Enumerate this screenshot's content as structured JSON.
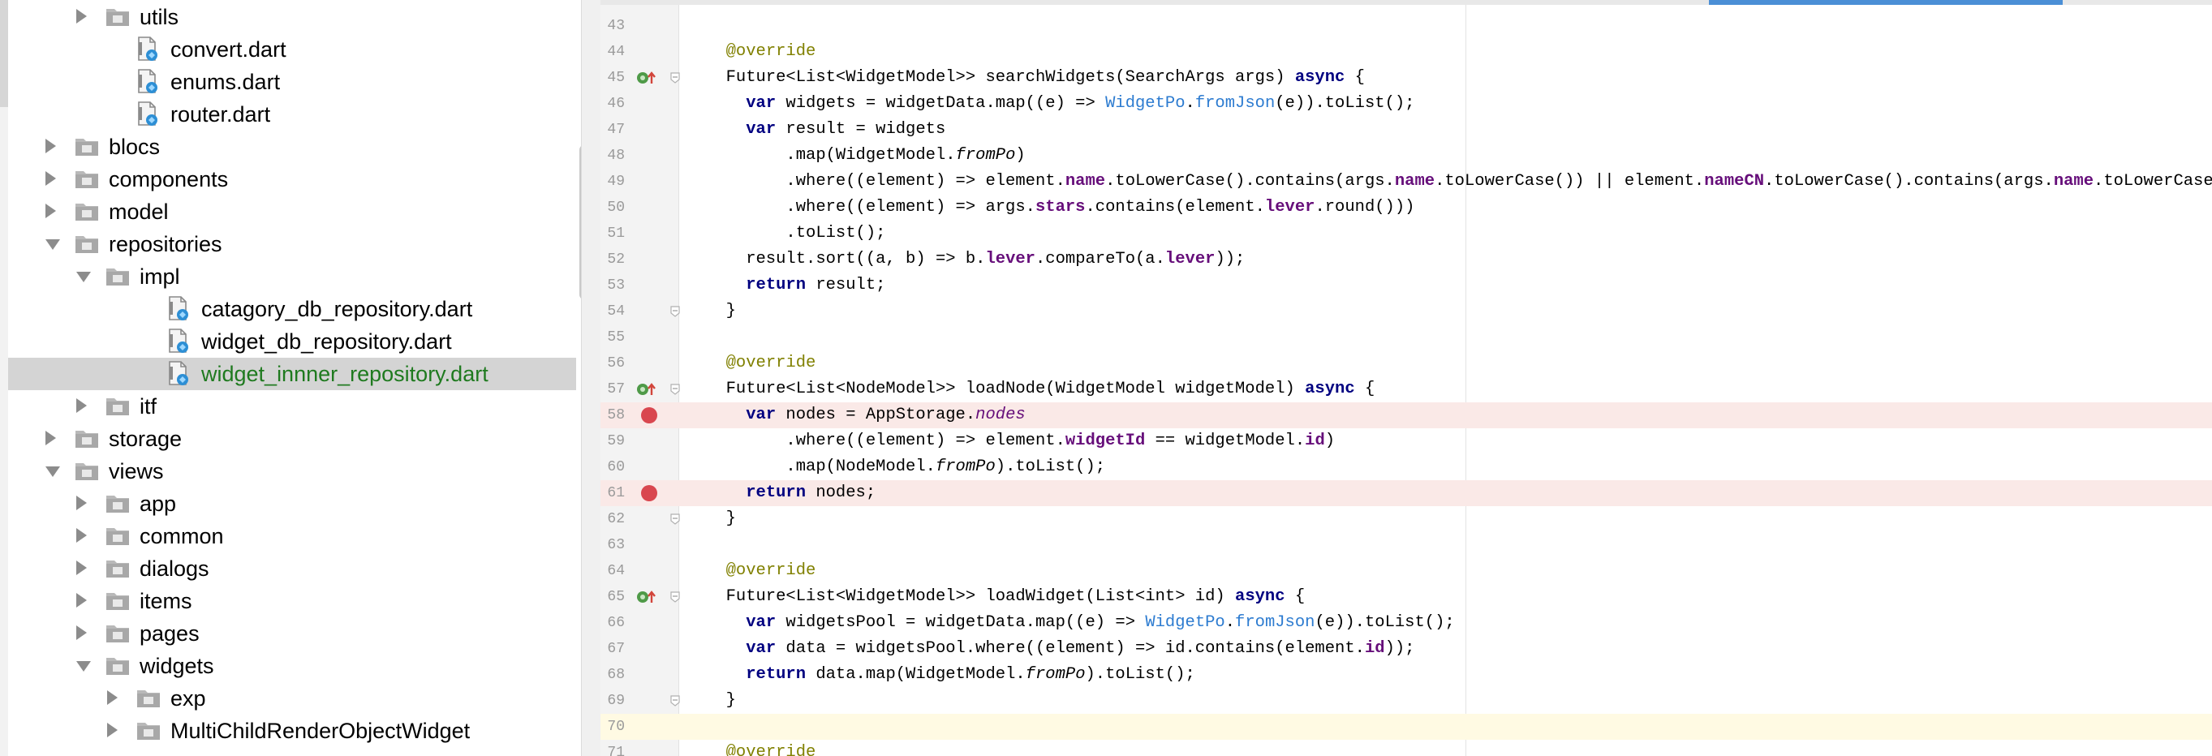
{
  "project_tree": {
    "items": [
      {
        "label": "utils",
        "kind": "folder",
        "state": "collapsed",
        "depth": 2
      },
      {
        "label": "convert.dart",
        "kind": "dart-file",
        "depth": 3
      },
      {
        "label": "enums.dart",
        "kind": "dart-file",
        "depth": 3
      },
      {
        "label": "router.dart",
        "kind": "dart-file",
        "depth": 3
      },
      {
        "label": "blocs",
        "kind": "folder",
        "state": "collapsed",
        "depth": 1
      },
      {
        "label": "components",
        "kind": "folder",
        "state": "collapsed",
        "depth": 1
      },
      {
        "label": "model",
        "kind": "folder",
        "state": "collapsed",
        "depth": 1
      },
      {
        "label": "repositories",
        "kind": "folder",
        "state": "expanded",
        "depth": 1
      },
      {
        "label": "impl",
        "kind": "folder",
        "state": "expanded",
        "depth": 2
      },
      {
        "label": "catagory_db_repository.dart",
        "kind": "dart-file",
        "depth": 4
      },
      {
        "label": "widget_db_repository.dart",
        "kind": "dart-file",
        "depth": 4
      },
      {
        "label": "widget_innner_repository.dart",
        "kind": "dart-file",
        "depth": 4,
        "selected": true
      },
      {
        "label": "itf",
        "kind": "folder",
        "state": "collapsed",
        "depth": 2
      },
      {
        "label": "storage",
        "kind": "folder",
        "state": "collapsed",
        "depth": 1
      },
      {
        "label": "views",
        "kind": "folder",
        "state": "expanded",
        "depth": 1
      },
      {
        "label": "app",
        "kind": "folder",
        "state": "collapsed",
        "depth": 2
      },
      {
        "label": "common",
        "kind": "folder",
        "state": "collapsed",
        "depth": 2
      },
      {
        "label": "dialogs",
        "kind": "folder",
        "state": "collapsed",
        "depth": 2
      },
      {
        "label": "items",
        "kind": "folder",
        "state": "collapsed",
        "depth": 2
      },
      {
        "label": "pages",
        "kind": "folder",
        "state": "collapsed",
        "depth": 2
      },
      {
        "label": "widgets",
        "kind": "folder",
        "state": "expanded",
        "depth": 2
      },
      {
        "label": "exp",
        "kind": "folder",
        "state": "collapsed",
        "depth": 3
      },
      {
        "label": "MultiChildRenderObjectWidget",
        "kind": "folder",
        "state": "collapsed",
        "depth": 3
      }
    ]
  },
  "editor": {
    "lines": [
      {
        "no": "43",
        "code": ""
      },
      {
        "no": "44",
        "code": "  @override"
      },
      {
        "no": "45",
        "code": "  Future<List<WidgetModel>> searchWidgets(SearchArgs args) async {",
        "override": true,
        "fold": true
      },
      {
        "no": "46",
        "code": "    var widgets = widgetData.map((e) => WidgetPo.fromJson(e)).toList();"
      },
      {
        "no": "47",
        "code": "    var result = widgets"
      },
      {
        "no": "48",
        "code": "        .map(WidgetModel.fromPo)"
      },
      {
        "no": "49",
        "code": "        .where((element) => element.name.toLowerCase().contains(args.name.toLowerCase()) || element.nameCN.toLowerCase().contains(args.name.toLowerCase()))"
      },
      {
        "no": "50",
        "code": "        .where((element) => args.stars.contains(element.lever.round()))"
      },
      {
        "no": "51",
        "code": "        .toList();"
      },
      {
        "no": "52",
        "code": "    result.sort((a, b) => b.lever.compareTo(a.lever));"
      },
      {
        "no": "53",
        "code": "    return result;"
      },
      {
        "no": "54",
        "code": "  }",
        "fold": true
      },
      {
        "no": "55",
        "code": ""
      },
      {
        "no": "56",
        "code": "  @override"
      },
      {
        "no": "57",
        "code": "  Future<List<NodeModel>> loadNode(WidgetModel widgetModel) async {",
        "override": true,
        "fold": true
      },
      {
        "no": "58",
        "code": "    var nodes = AppStorage.nodes",
        "breakpoint": true
      },
      {
        "no": "59",
        "code": "        .where((element) => element.widgetId == widgetModel.id)"
      },
      {
        "no": "60",
        "code": "        .map(NodeModel.fromPo).toList();"
      },
      {
        "no": "61",
        "code": "    return nodes;",
        "breakpoint": true
      },
      {
        "no": "62",
        "code": "  }",
        "fold": true
      },
      {
        "no": "63",
        "code": ""
      },
      {
        "no": "64",
        "code": "  @override"
      },
      {
        "no": "65",
        "code": "  Future<List<WidgetModel>> loadWidget(List<int> id) async {",
        "override": true,
        "fold": true
      },
      {
        "no": "66",
        "code": "    var widgetsPool = widgetData.map((e) => WidgetPo.fromJson(e)).toList();"
      },
      {
        "no": "67",
        "code": "    var data = widgetsPool.where((element) => id.contains(element.id));"
      },
      {
        "no": "68",
        "code": "    return data.map(WidgetModel.fromPo).toList();"
      },
      {
        "no": "69",
        "code": "  }",
        "fold": true
      },
      {
        "no": "70",
        "code": "",
        "caret": true
      },
      {
        "no": "71",
        "code": "  @override"
      }
    ]
  },
  "colors": {
    "selected_file_text": "#1f7a1f",
    "keyword": "#000080",
    "annotation": "#808000",
    "class_ref": "#2c7bd0",
    "field": "#660e7a",
    "breakpoint": "#d9474f",
    "breakpoint_line_bg": "#fae9e7",
    "caret_line_bg": "#fffae3"
  },
  "icons": {
    "folder": "folder-icon",
    "dart_file": "dart-file-icon",
    "breakpoint": "breakpoint-icon",
    "override": "override-method-icon",
    "fold": "fold-icon"
  }
}
